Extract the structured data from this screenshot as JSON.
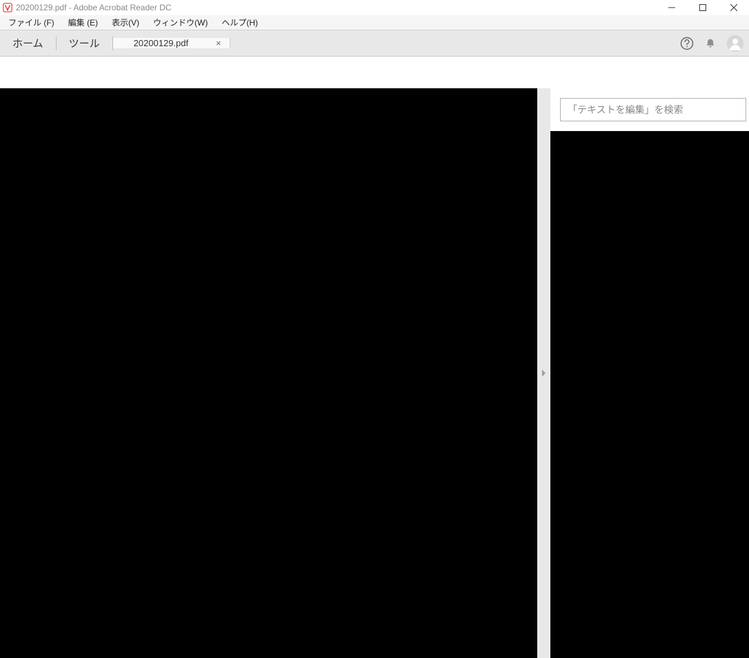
{
  "titlebar": {
    "text": "20200129.pdf - Adobe Acrobat Reader DC"
  },
  "menubar": {
    "items": [
      "ファイル (F)",
      "編集 (E)",
      "表示(V)",
      "ウィンドウ(W)",
      "ヘルプ(H)"
    ]
  },
  "tabs": {
    "home": "ホーム",
    "tools": "ツール",
    "document": "20200129.pdf"
  },
  "search": {
    "placeholder": "「テキストを編集」を検索"
  }
}
